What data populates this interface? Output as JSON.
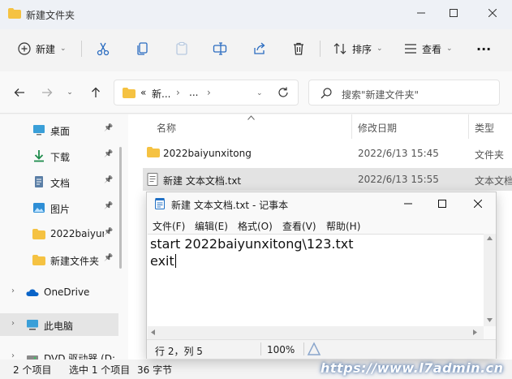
{
  "window": {
    "title": "新建文件夹"
  },
  "toolbar": {
    "new_label": "新建",
    "sort_label": "排序",
    "view_label": "查看",
    "more": "···"
  },
  "address": {
    "prefix": "«",
    "crumb1": "新...",
    "crumb2": "...",
    "sep": "›",
    "search_placeholder": "搜索\"新建文件夹\""
  },
  "sidebar": {
    "items": [
      {
        "label": "桌面",
        "pinned": true
      },
      {
        "label": "下载",
        "pinned": true
      },
      {
        "label": "文档",
        "pinned": true
      },
      {
        "label": "图片",
        "pinned": true
      },
      {
        "label": "2022baiyur",
        "pinned": true
      },
      {
        "label": "新建文件夹",
        "pinned": true
      },
      {
        "label": "OneDrive"
      },
      {
        "label": "此电脑"
      },
      {
        "label": "DVD 驱动器 (D:"
      }
    ],
    "pin_glyph": "📌"
  },
  "filelist": {
    "headers": {
      "name": "名称",
      "date": "修改日期",
      "type": "类型"
    },
    "rows": [
      {
        "name": "2022baiyunxitong",
        "date": "2022/6/13 15:45",
        "type": "文件夹"
      },
      {
        "name": "新建 文本文档.txt",
        "date": "2022/6/13 15:55",
        "type": "文本文档"
      }
    ]
  },
  "status": {
    "count": "2 个项目",
    "selected": "选中 1 个项目",
    "size": "36 字节"
  },
  "notepad": {
    "title": "新建 文本文档.txt - 记事本",
    "menu": [
      "文件(F)",
      "编辑(E)",
      "格式(O)",
      "查看(V)",
      "帮助(H)"
    ],
    "lines": [
      "start 2022baiyunxitong\\123.txt",
      "exit"
    ],
    "status": {
      "pos": "行 2，列 5",
      "zoom": "100%"
    }
  },
  "watermark": "https://www.l7admin.cn",
  "colors": {
    "folder": "#f5c242",
    "accent": "#0067c0"
  }
}
